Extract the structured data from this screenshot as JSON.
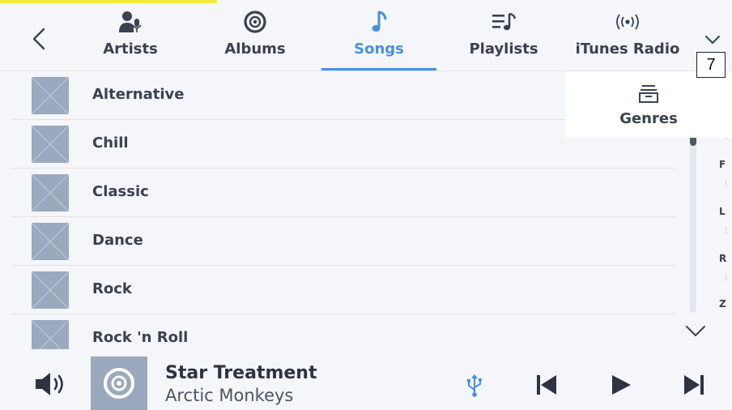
{
  "nav": {
    "back_icon": "chevron-left-icon",
    "tabs": [
      {
        "label": "Artists",
        "icon": "artist-mic-icon",
        "active": false
      },
      {
        "label": "Albums",
        "icon": "album-disc-icon",
        "active": false
      },
      {
        "label": "Songs",
        "icon": "music-note-icon",
        "active": true
      },
      {
        "label": "Playlists",
        "icon": "playlist-icon",
        "active": false
      },
      {
        "label": "iTunes Radio",
        "icon": "radio-waves-icon",
        "active": false
      }
    ],
    "more_icon": "chevron-down-icon",
    "badge": "7"
  },
  "dropdown": {
    "items": [
      {
        "label": "Genres",
        "icon": "genres-box-icon"
      }
    ]
  },
  "genres": {
    "items": [
      {
        "label": "Alternative"
      },
      {
        "label": "Chill"
      },
      {
        "label": "Classic"
      },
      {
        "label": "Dance"
      },
      {
        "label": "Rock"
      },
      {
        "label": "Rock 'n Roll"
      }
    ]
  },
  "index": {
    "letters": [
      "F",
      "L",
      "R",
      "Z"
    ]
  },
  "player": {
    "title": "Star Treatment",
    "artist": "Arctic Monkeys",
    "source_icon": "usb-icon"
  },
  "colors": {
    "accent": "#4a90d9",
    "background": "#f4f6f9",
    "placeholder": "#9aa9bd",
    "text": "#3a4250",
    "highlight": "#f5ea3c"
  }
}
